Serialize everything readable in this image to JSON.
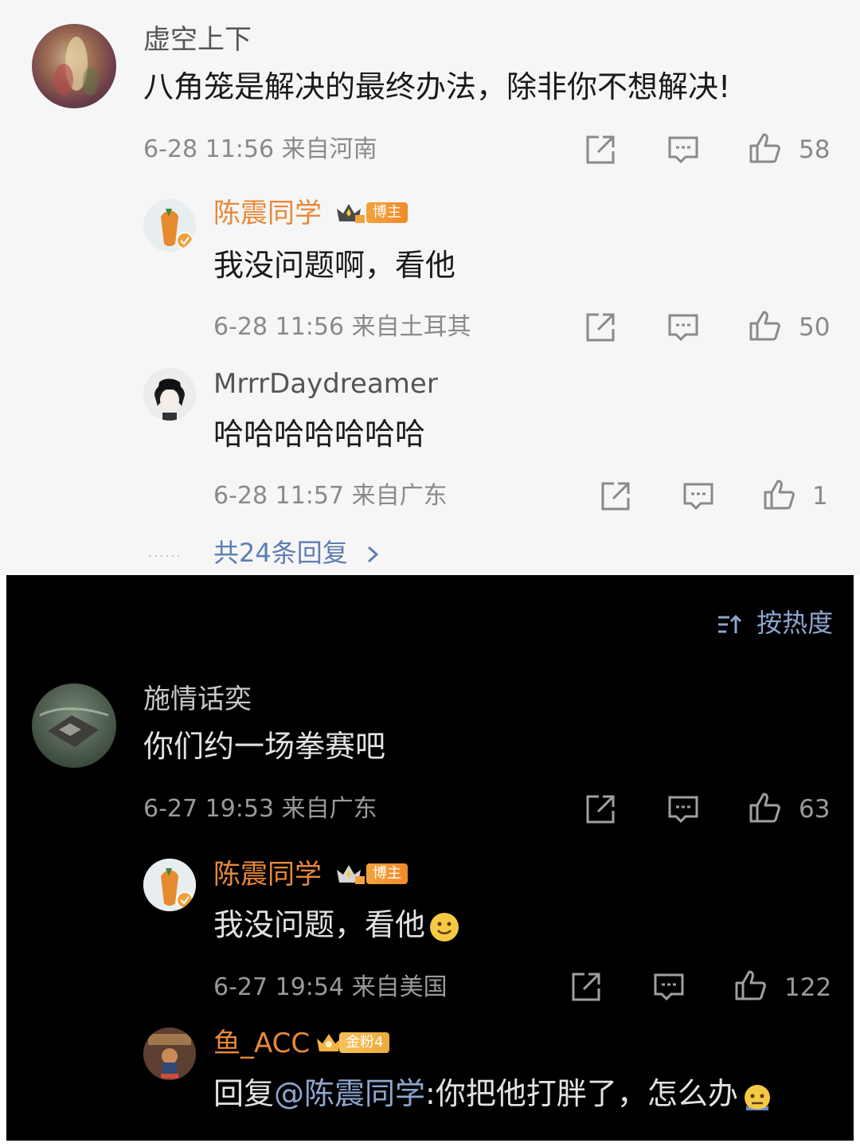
{
  "light_section": {
    "comment": {
      "author": "虚空上下",
      "text": "八角笼是解决的最终办法，除非你不想解决!",
      "meta": "6-28 11:56  来自河南",
      "likes": "58"
    },
    "replies": [
      {
        "author": "陈震同学",
        "badge": "博主",
        "text": "我没问题啊，看他",
        "meta": "6-28 11:56  来自土耳其",
        "likes": "50"
      },
      {
        "author": "MrrrDaydreamer",
        "text": "哈哈哈哈哈哈哈",
        "meta": "6-28 11:57  来自广东",
        "likes": "1"
      }
    ],
    "more_replies": "共24条回复",
    "more_dots": "......"
  },
  "dark_section": {
    "sort_label": "按热度",
    "comment": {
      "author": "施情话奕",
      "text": "你们约一场拳赛吧",
      "meta": "6-27 19:53  来自广东",
      "likes": "63"
    },
    "replies": [
      {
        "author": "陈震同学",
        "badge": "博主",
        "text": "我没问题，看他",
        "meta": "6-27 19:54  来自美国",
        "likes": "122"
      },
      {
        "author": "鱼_ACC",
        "badge": "金粉4",
        "reply_prefix": "回复",
        "mention": "@陈震同学",
        "text": ":你把他打胖了，怎么办"
      }
    ]
  },
  "colors": {
    "light_bg": "#f6f6f6",
    "dark_bg": "#000000",
    "orange_name": "#e8893a",
    "link_blue": "#8da6cf"
  },
  "icons": [
    "share-icon",
    "comment-icon",
    "like-icon",
    "sort-icon",
    "crown-icon",
    "smile-emoji-icon",
    "sweat-emoji-icon"
  ]
}
